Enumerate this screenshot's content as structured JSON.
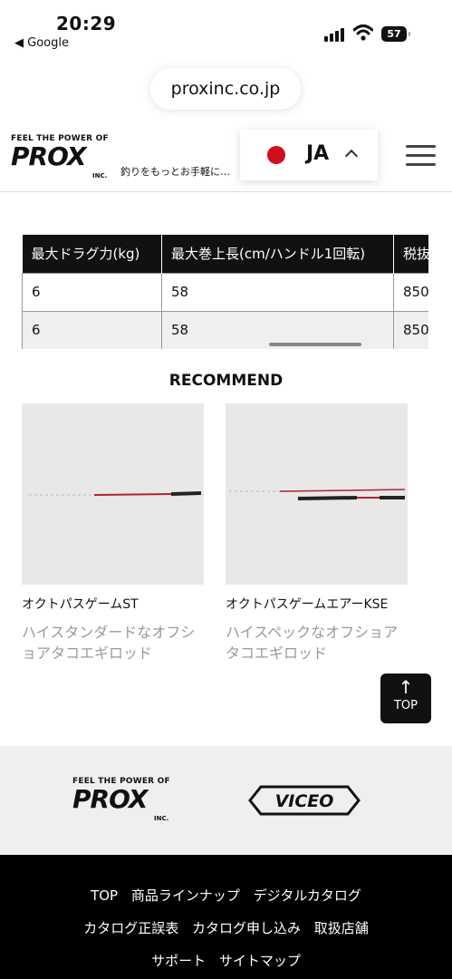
{
  "status_bar": {
    "time": "20:29",
    "back_app": "◀ Google",
    "battery": "57"
  },
  "browser": {
    "url": "proxinc.co.jp"
  },
  "header": {
    "logo_tagline": "FEEL THE POWER OF",
    "logo_word": "PROX",
    "logo_inc": "INC.",
    "catchphrase": "釣りをもっとお手軽に…",
    "language": "JA",
    "flag_color": "#d0101b"
  },
  "spec_table": {
    "headers": [
      "最大ドラグ力(kg)",
      "最大巻上長(cm/ハンドル1回転)",
      "税抜"
    ],
    "rows": [
      [
        "6",
        "58",
        "850"
      ],
      [
        "6",
        "58",
        "850"
      ]
    ]
  },
  "recommend": {
    "title": "RECOMMEND",
    "items": [
      {
        "name": "オクトパスゲームST",
        "description": "ハイスタンダードなオフショアタコエギロッド"
      },
      {
        "name": "オクトパスゲームエアーKSE",
        "description": "ハイスペックなオフショアタコエギロッド"
      }
    ]
  },
  "top_button": {
    "arrow": "↑",
    "label": "TOP"
  },
  "brands": {
    "prox_tagline": "FEEL THE POWER OF",
    "prox_word": "PROX",
    "prox_inc": "INC.",
    "viceo_word": "VICEO"
  },
  "footer": {
    "links_row1": [
      "TOP",
      "商品ラインナップ",
      "デジタルカタログ"
    ],
    "links_row2": [
      "カタログ正誤表",
      "カタログ申し込み",
      "取扱店舗"
    ],
    "links_row3": [
      "サポート",
      "サイトマップ"
    ]
  }
}
